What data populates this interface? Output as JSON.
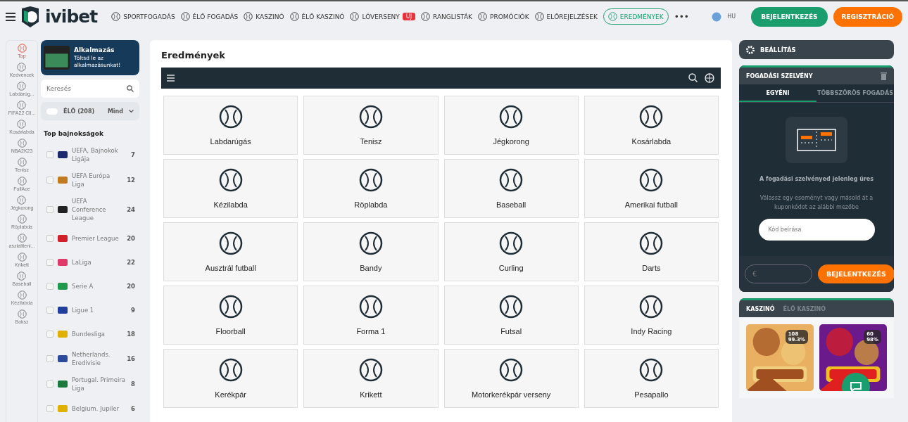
{
  "header": {
    "logo": "ivibet",
    "nav": [
      {
        "label": "SPORTFOGADÁS",
        "selected": false
      },
      {
        "label": "ÉLŐ FOGADÁS",
        "selected": false
      },
      {
        "label": "KASZINÓ",
        "selected": false
      },
      {
        "label": "ÉLŐ KASZINÓ",
        "selected": false
      },
      {
        "label": "LÓVERSENY",
        "selected": false,
        "badge": "ÚJ"
      },
      {
        "label": "RANGLISTÁK",
        "selected": false
      },
      {
        "label": "PROMÓCIÓK",
        "selected": false
      },
      {
        "label": "ELŐREJELZÉSEK",
        "selected": false
      },
      {
        "label": "EREDMÉNYEK",
        "selected": true
      }
    ],
    "more": "•••",
    "language": "HU",
    "login": "BEJELENTKEZÉS",
    "register": "REGISZTRÁCIÓ"
  },
  "rail": [
    {
      "label": "Top",
      "selected": true
    },
    {
      "label": "Kedvencek",
      "selected": false
    },
    {
      "label": "Labdarúg...",
      "selected": false
    },
    {
      "label": "FIFA22 Cli...",
      "selected": false
    },
    {
      "label": "Kosárlabda",
      "selected": false
    },
    {
      "label": "NBA2K23",
      "selected": false
    },
    {
      "label": "Tenisz",
      "selected": false
    },
    {
      "label": "FullAce",
      "selected": false
    },
    {
      "label": "Jégkorong",
      "selected": false
    },
    {
      "label": "Röplabda",
      "selected": false
    },
    {
      "label": "asztaliteni...",
      "selected": false
    },
    {
      "label": "Krikett",
      "selected": false
    },
    {
      "label": "Baseball",
      "selected": false
    },
    {
      "label": "Kézilabda",
      "selected": false
    },
    {
      "label": "Boksz",
      "selected": false
    }
  ],
  "sidebar": {
    "app_banner": {
      "title": "Alkalmazás",
      "text": "Töltsd le az alkalmazásunkat!"
    },
    "search": {
      "placeholder": "Keresés"
    },
    "live": {
      "on": false,
      "label": "ÉLŐ (208)",
      "filter": "Mind"
    },
    "section_title": "Top bajnokságok",
    "leagues": [
      {
        "name": "UEFA, Bajnokok Ligája",
        "count": "7",
        "checked": false,
        "color": "#1a2a6c"
      },
      {
        "name": "UEFA Európa Liga",
        "count": "12",
        "checked": false,
        "color": "#c07a20"
      },
      {
        "name": "UEFA Conference League",
        "count": "24",
        "checked": false,
        "color": "#222222"
      },
      {
        "name": "Premier League",
        "count": "20",
        "checked": false,
        "color": "#d0202a"
      },
      {
        "name": "LaLiga",
        "count": "22",
        "checked": false,
        "color": "#e03a6a"
      },
      {
        "name": "Serie A",
        "count": "20",
        "checked": false,
        "color": "#1f9a4a"
      },
      {
        "name": "Ligue 1",
        "count": "9",
        "checked": false,
        "color": "#1f3f9a"
      },
      {
        "name": "Bundesliga",
        "count": "18",
        "checked": false,
        "color": "#e0b000"
      },
      {
        "name": "Netherlands. Eredivisie",
        "count": "16",
        "checked": false,
        "color": "#2a4a9a"
      },
      {
        "name": "Portugal. Primeira Liga",
        "count": "8",
        "checked": false,
        "color": "#1a7a3a"
      },
      {
        "name": "Belgium. Jupiler",
        "count": "6",
        "checked": false,
        "color": "#e0b000"
      }
    ]
  },
  "main": {
    "title": "Eredmények",
    "sports": [
      "Labdarúgás",
      "Tenisz",
      "Jégkorong",
      "Kosárlabda",
      "Kézilabda",
      "Röplabda",
      "Baseball",
      "Amerikai futball",
      "Ausztrál futball",
      "Bandy",
      "Curling",
      "Darts",
      "Floorball",
      "Forma 1",
      "Futsal",
      "Indy Racing",
      "Kerékpár",
      "Krikett",
      "Motorkerékpár verseny",
      "Pesapallo"
    ]
  },
  "right": {
    "settings": "BEÁLLÍTÁS",
    "betslip": {
      "title": "FOGADÁSI SZELVÉNY",
      "tabs": [
        {
          "label": "EGYÉNI",
          "selected": true
        },
        {
          "label": "TÖBBSZÖRÖS FOGADÁS",
          "selected": false
        }
      ],
      "empty_title": "A fogadási szelvényed jelenleg üres",
      "empty_text": "Válassz egy eseményt vagy másold át a kuponkódot az alábbi mezőbe",
      "code": {
        "placeholder": "Kód beírása"
      },
      "stake": {
        "placeholder": "€"
      },
      "login": "BEJELENTKEZÉS"
    },
    "casino": {
      "tabs": [
        {
          "label": "KASZINÓ",
          "selected": true
        },
        {
          "label": "ÉLŐ KASZINÓ",
          "selected": false
        }
      ],
      "games": [
        {
          "kind": "picture",
          "players": "108",
          "rtp": "99.3%"
        },
        {
          "kind": "picture",
          "players": "60",
          "rtp": "98%"
        }
      ]
    }
  }
}
